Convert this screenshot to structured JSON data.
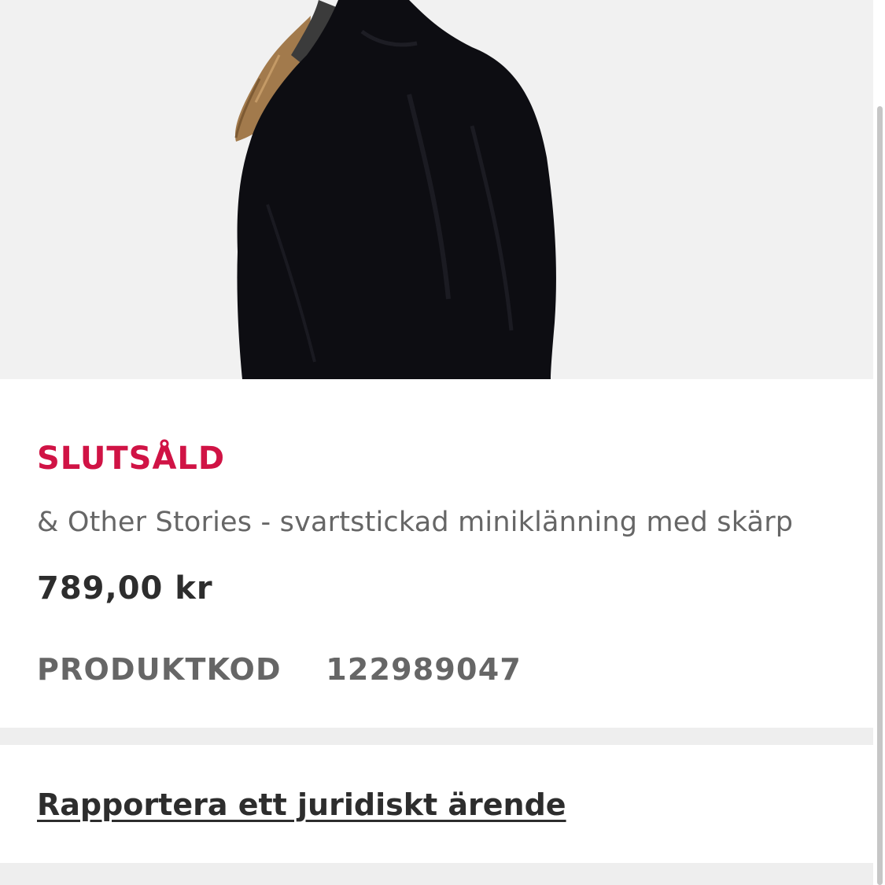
{
  "product": {
    "status": "SLUTSÅLD",
    "name": "& Other Stories - svartstickad miniklänning med skärp",
    "price": "789,00 kr",
    "code_label": "PRODUKTKOD",
    "code_value": "122989047",
    "image_alt": "& Other Stories - svartstickad miniklänning med skärp"
  },
  "legal": {
    "link_label": "Rapportera ett juridiskt ärende"
  },
  "colors": {
    "sold_out": "#d01345",
    "text_primary": "#2d2d2d",
    "text_secondary": "#666666",
    "separator": "#eeeeee"
  }
}
